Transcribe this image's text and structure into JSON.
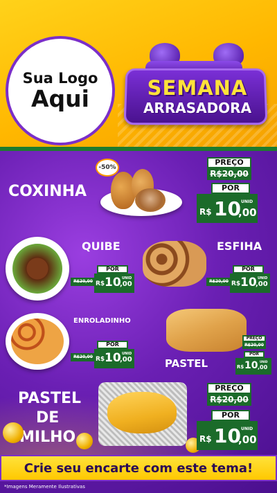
{
  "header": {
    "logo_line1": "Sua Logo",
    "logo_line2": "Aqui",
    "banner_line1": "SEMANA",
    "banner_line2": "ARRASADORA"
  },
  "colors": {
    "header_yellow": "#ffc200",
    "main_purple": "#6a1fb3",
    "price_green": "#1b6b2a",
    "accent_yellow": "#ffe23a"
  },
  "products": [
    {
      "name": "COXINHA",
      "discount_badge": "-50%",
      "label_preco": "PREÇO",
      "old_price": "R$20,00",
      "label_por": "POR",
      "currency": "R$",
      "price_int": "10",
      "price_dec": ",00",
      "unit": "UNID"
    },
    {
      "name": "QUIBE",
      "label_por": "POR",
      "old_price": "R$20,00",
      "currency": "R$",
      "price_int": "10",
      "price_dec": ",00",
      "unit": "UNID"
    },
    {
      "name": "ESFIHA",
      "label_por": "POR",
      "old_price": "R$20,00",
      "currency": "R$",
      "price_int": "10",
      "price_dec": ",00",
      "unit": "UNID"
    },
    {
      "name": "ENROLADINHO",
      "label_por": "POR",
      "old_price": "R$20,00",
      "currency": "R$",
      "price_int": "10",
      "price_dec": ",00",
      "unit": "UNID"
    },
    {
      "name": "PASTEL",
      "label_preco": "PREÇO",
      "old_price": "R$20,00",
      "label_por": "POR",
      "currency": "R$",
      "price_int": "10",
      "price_dec": ",00",
      "unit": "UNID"
    },
    {
      "name_line1": "PASTEL",
      "name_line2": "DE",
      "name_line3": "MILHO",
      "label_preco": "PREÇO",
      "old_price": "R$20,00",
      "label_por": "POR",
      "currency": "R$",
      "price_int": "10",
      "price_dec": ",00",
      "unit": "UNID"
    }
  ],
  "cta_text": "Crie seu encarte com este tema!",
  "disclaimer": "*Imagens Meramente Ilustrativas"
}
